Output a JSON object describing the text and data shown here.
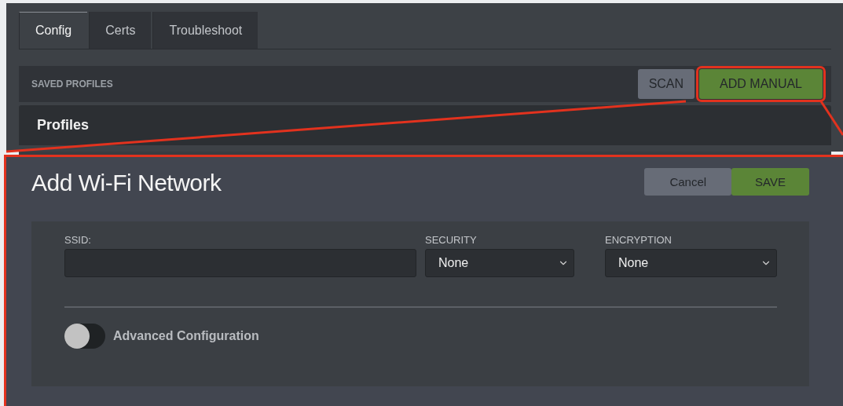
{
  "tabs": [
    {
      "label": "Config",
      "selected": true
    },
    {
      "label": "Certs",
      "selected": false
    },
    {
      "label": "Troubleshoot",
      "selected": false
    }
  ],
  "saved_profiles": {
    "title": "SAVED PROFILES",
    "buttons": [
      {
        "label": "SCAN",
        "kind": "secondary",
        "highlighted": false
      },
      {
        "label": "ADD MANUAL",
        "kind": "primary",
        "highlighted": true
      }
    ]
  },
  "profiles": {
    "title": "Profiles"
  },
  "dialog": {
    "title": "Add Wi-Fi Network",
    "highlighted": true,
    "buttons": [
      {
        "label": "Cancel",
        "kind": "secondary"
      },
      {
        "label": "SAVE",
        "kind": "primary"
      }
    ],
    "fields": [
      {
        "kind": "text",
        "label": "SSID:"
      },
      {
        "kind": "select",
        "label": "SECURITY",
        "value": "None"
      },
      {
        "kind": "select",
        "label": "ENCRYPTION",
        "value": "None"
      }
    ],
    "toggle": {
      "label": "Advanced Configuration",
      "on": false
    }
  }
}
